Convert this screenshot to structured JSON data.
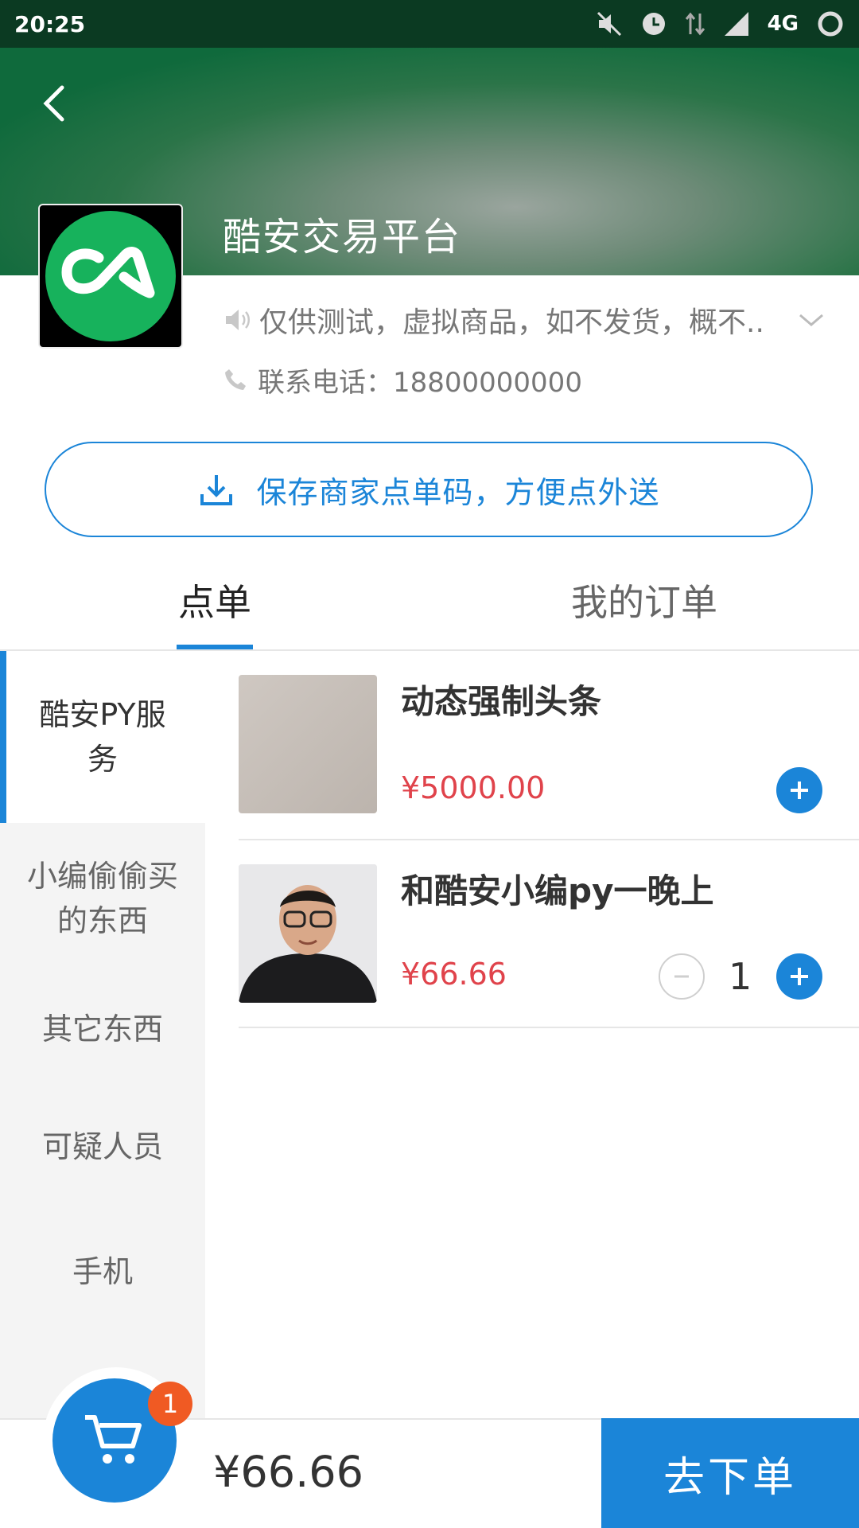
{
  "status_bar": {
    "time": "20:25",
    "network": "4G",
    "icons": [
      "mute-icon",
      "alarm-icon",
      "data-arrows-icon",
      "signal-icon",
      "loading-icon"
    ]
  },
  "header": {
    "back_icon": "chevron-left-icon",
    "shop_name": "酷安交易平台",
    "logo_icon": "coolapk-logo"
  },
  "info": {
    "notice_icon": "speaker-icon",
    "notice": "仅供测试，虚拟商品，如不发货，概不..",
    "expand_icon": "chevron-down-icon",
    "phone_icon": "phone-icon",
    "phone": "联系电话：18800000000"
  },
  "save_button": {
    "icon": "download-icon",
    "label": "保存商家点单码，方便点外送"
  },
  "tabs": [
    {
      "label": "点单",
      "active": true
    },
    {
      "label": "我的订单",
      "active": false
    }
  ],
  "categories": [
    {
      "label": "酷安PY服务",
      "active": true
    },
    {
      "label": "小编偷偷买的东西",
      "active": false
    },
    {
      "label": "其它东西",
      "active": false
    },
    {
      "label": "可疑人员",
      "active": false
    },
    {
      "label": "手机",
      "active": false
    }
  ],
  "products": [
    {
      "name": "动态强制头条",
      "price": "¥5000.00",
      "quantity": null
    },
    {
      "name": "和酷安小编py一晚上",
      "price": "¥66.66",
      "quantity": "1"
    }
  ],
  "cart": {
    "icon": "shopping-cart-icon",
    "badge": "1",
    "total": "¥66.66"
  },
  "checkout_label": "去下单",
  "colors": {
    "accent": "#1b85d8",
    "price": "#e0434b",
    "badge": "#f05a23",
    "header_green": "#0f6a3c"
  }
}
